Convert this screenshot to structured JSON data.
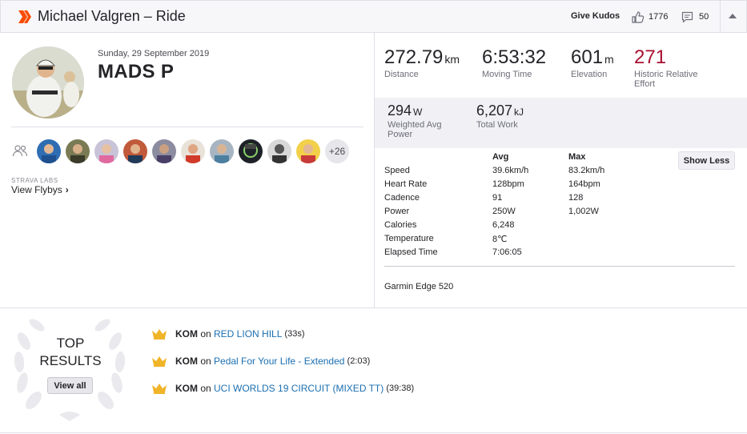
{
  "header": {
    "title": "Michael Valgren – Ride",
    "give_kudos_label": "Give Kudos",
    "kudos_count": "1776",
    "comments_count": "50",
    "brand_color": "#fc4c02"
  },
  "athlete": {
    "date": "Sunday, 29 September 2019",
    "name": "MADS P"
  },
  "group": {
    "more_count": "+26",
    "labs_label": "STRAVA LABS",
    "flybys_label": "View Flybys",
    "flybys_chevron": "›"
  },
  "stats": {
    "primary": [
      {
        "value": "272.79",
        "unit": "km",
        "label": "Distance"
      },
      {
        "value": "6:53:32",
        "unit": "",
        "label": "Moving Time"
      },
      {
        "value": "601",
        "unit": "m",
        "label": "Elevation"
      },
      {
        "value": "271",
        "unit": "",
        "label": "Historic Relative Effort"
      }
    ],
    "secondary": [
      {
        "value": "294",
        "unit": "W",
        "label": "Weighted Avg Power"
      },
      {
        "value": "6,207",
        "unit": "kJ",
        "label": "Total Work"
      }
    ],
    "effort_color": "#a8102f"
  },
  "details": {
    "show_less_label": "Show Less",
    "avg_header": "Avg",
    "max_header": "Max",
    "rows": [
      {
        "label": "Speed",
        "avg": "39.6km/h",
        "max": "83.2km/h"
      },
      {
        "label": "Heart Rate",
        "avg": "128bpm",
        "max": "164bpm"
      },
      {
        "label": "Cadence",
        "avg": "91",
        "max": "128"
      },
      {
        "label": "Power",
        "avg": "250W",
        "max": "1,002W"
      },
      {
        "label": "Calories",
        "avg": "6,248",
        "max": ""
      },
      {
        "label": "Temperature",
        "avg": "8℃",
        "max": ""
      },
      {
        "label": "Elapsed Time",
        "avg": "7:06:05",
        "max": ""
      }
    ],
    "device": "Garmin Edge 520"
  },
  "top_results": {
    "title_line1": "TOP",
    "title_line2": "RESULTS",
    "view_all_label": "View all",
    "items": [
      {
        "badge": "KOM",
        "on": " on ",
        "segment": "RED LION HILL",
        "time": " (33s)"
      },
      {
        "badge": "KOM",
        "on": " on ",
        "segment": "Pedal For Your Life - Extended",
        "time": " (2:03)"
      },
      {
        "badge": "KOM",
        "on": " on ",
        "segment": "UCI WORLDS 19 CIRCUIT (MIXED TT)",
        "time": " (39:38)"
      }
    ],
    "crown_color": "#f0b429",
    "link_color": "#1c6fb0"
  }
}
